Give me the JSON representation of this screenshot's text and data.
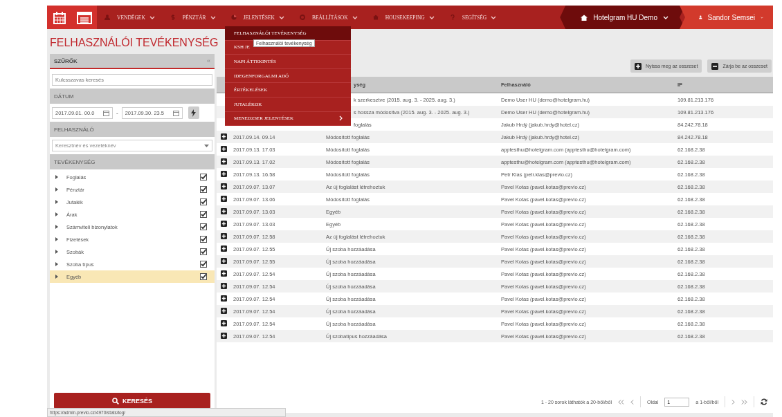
{
  "page_title": "FELHASZNÁLÓI TEVÉKENYSÉG",
  "nav": {
    "items": [
      {
        "label": "VENDÉGEK",
        "kind": "guests"
      },
      {
        "label": "PÉNZTÁR",
        "kind": "cash"
      },
      {
        "label": "JELENTÉSEK",
        "kind": "reports"
      },
      {
        "label": "BEÁLLÍTÁSOK",
        "kind": "settings"
      },
      {
        "label": "HOUSEKEEPING",
        "kind": "housekeeping"
      },
      {
        "label": "SEGÍTSÉG",
        "kind": "help"
      }
    ],
    "hotel": "Hotelgram HU Demo",
    "user": "Sandor Semsei"
  },
  "reports_menu": {
    "items": [
      {
        "label": "FELHASZNÁLÓI TEVÉKENYSÉG",
        "selected": true,
        "submenu": false
      },
      {
        "label": "KSH JE",
        "selected": false,
        "submenu": false
      },
      {
        "label": "NAPI ÁTTEKINTÉS",
        "selected": false,
        "submenu": false
      },
      {
        "label": "IDEGENFORGALMI ADÓ",
        "selected": false,
        "submenu": false
      },
      {
        "label": "ÉRTÉKELÉSEK",
        "selected": false,
        "submenu": false
      },
      {
        "label": "JUTALÉKOK",
        "selected": false,
        "submenu": false
      },
      {
        "label": "MENEDZSER JELENTÉSEK",
        "selected": false,
        "submenu": true
      }
    ],
    "tooltip": "Felhasználói tevékenység"
  },
  "filters": {
    "title": "SZŰRŐK",
    "collapse_symbol": "«",
    "date_separator": "-",
    "keyword": {
      "placeholder": "Kulcsszavas keresés"
    },
    "date_label": "DÁTUM",
    "date_from": "2017.09.01. 00.0",
    "date_to": "2017.09.30. 23.5",
    "user_label": "FELHASZNÁLÓ",
    "user_select": {
      "placeholder": "Keresztnév és vezetéknév"
    },
    "activity_label": "TEVÉKENYSÉG",
    "activities": [
      {
        "label": "Foglalás",
        "checked": true,
        "selected": false
      },
      {
        "label": "Pénztár",
        "checked": true,
        "selected": false
      },
      {
        "label": "Jutalék",
        "checked": true,
        "selected": false
      },
      {
        "label": "Árak",
        "checked": true,
        "selected": false
      },
      {
        "label": "Számviteli bizonylatok",
        "checked": true,
        "selected": false
      },
      {
        "label": "Fizetések",
        "checked": true,
        "selected": false
      },
      {
        "label": "Szobák",
        "checked": true,
        "selected": false
      },
      {
        "label": "Szoba típus",
        "checked": true,
        "selected": false
      },
      {
        "label": "Egyéb",
        "checked": true,
        "selected": true
      }
    ],
    "search_button": "KERESÉS"
  },
  "toolbar": {
    "expand_all": "Nyissa meg az osszeset",
    "collapse_all": "Zárja be az osszeset"
  },
  "table": {
    "columns": [
      "ység",
      "Felhasználó",
      "IP"
    ],
    "rows": [
      {
        "activity": "k szerkesztve (2015. aug. 3. - 2025. aug. 3.)",
        "user": "Demo User HU (demo@hotelgram.hu)",
        "ip": "109.81.213.176"
      },
      {
        "activity": "s hossza módosítva (2015. aug. 3. - 2025. aug. 3.)",
        "user": "Demo User HU (demo@hotelgram.hu)",
        "ip": "109.81.213.176"
      },
      {
        "activity": "foglalás",
        "user": "Jakub Hrdý (jakub.hrdy@hotel.cz)",
        "ip": "84.242.78.18"
      },
      {
        "date": "2017.09.14. 09.14",
        "activity": "Módosított foglalás",
        "user": "Jakub Hrdý (jakub.hrdy@hotel.cz)",
        "ip": "84.242.78.18"
      },
      {
        "date": "2017.09.13. 17.03",
        "activity": "Módosított foglalás",
        "user": "apptesthu@hotelgram.com (apptesthu@hotelgram.com)",
        "ip": "62.168.2.38"
      },
      {
        "date": "2017.09.13. 17.02",
        "activity": "Módosított foglalás",
        "user": "apptesthu@hotelgram.com (apptesthu@hotelgram.com)",
        "ip": "62.168.2.38"
      },
      {
        "date": "2017.09.13. 16.58",
        "activity": "Módosított foglalás",
        "user": "Petr Klas (petr.klas@previo.cz)",
        "ip": "62.168.2.38"
      },
      {
        "date": "2017.09.07. 13.07",
        "activity": "Az új foglalást létrehoztuk",
        "user": "Pavel Kotas (pavel.kotas@previo.cz)",
        "ip": "62.168.2.38"
      },
      {
        "date": "2017.09.07. 13.06",
        "activity": "Módosított foglalás",
        "user": "Pavel Kotas (pavel.kotas@previo.cz)",
        "ip": "62.168.2.38"
      },
      {
        "date": "2017.09.07. 13.03",
        "activity": "Egyéb",
        "user": "Pavel Kotas (pavel.kotas@previo.cz)",
        "ip": "62.168.2.38"
      },
      {
        "date": "2017.09.07. 13.03",
        "activity": "Egyéb",
        "user": "Pavel Kotas (pavel.kotas@previo.cz)",
        "ip": "62.168.2.38"
      },
      {
        "date": "2017.09.07. 12.58",
        "activity": "Az új foglalást létrehoztuk",
        "user": "Pavel Kotas (pavel.kotas@previo.cz)",
        "ip": "62.168.2.38"
      },
      {
        "date": "2017.09.07. 12.55",
        "activity": "Új szoba hozzáadása",
        "user": "Pavel Kotas (pavel.kotas@previo.cz)",
        "ip": "62.168.2.38"
      },
      {
        "date": "2017.09.07. 12.55",
        "activity": "Új szoba hozzáadása",
        "user": "Pavel Kotas (pavel.kotas@previo.cz)",
        "ip": "62.168.2.38"
      },
      {
        "date": "2017.09.07. 12.54",
        "activity": "Új szoba hozzáadása",
        "user": "Pavel Kotas (pavel.kotas@previo.cz)",
        "ip": "62.168.2.38"
      },
      {
        "date": "2017.09.07. 12.54",
        "activity": "Új szoba hozzáadása",
        "user": "Pavel Kotas (pavel.kotas@previo.cz)",
        "ip": "62.168.2.38"
      },
      {
        "date": "2017.09.07. 12.54",
        "activity": "Új szoba hozzáadása",
        "user": "Pavel Kotas (pavel.kotas@previo.cz)",
        "ip": "62.168.2.38"
      },
      {
        "date": "2017.09.07. 12.54",
        "activity": "Új szoba hozzáadása",
        "user": "Pavel Kotas (pavel.kotas@previo.cz)",
        "ip": "62.168.2.38"
      },
      {
        "date": "2017.09.07. 12.54",
        "activity": "Új szoba hozzáadása",
        "user": "Pavel Kotas (pavel.kotas@previo.cz)",
        "ip": "62.168.2.38"
      },
      {
        "date": "2017.09.07. 12.54",
        "activity": "Új szobatípus hozzáadása",
        "user": "Pavel Kotas (pavel.kotas@previo.cz)",
        "ip": "62.168.2.38"
      }
    ]
  },
  "pagination": {
    "summary": "1 - 20 sorok láthatók a 20-ből/ből",
    "page_label": "Oldal",
    "page": "1",
    "page_count": "a 1-ből/ből"
  },
  "status_url": "https://admin.previo.cz/4970/stats/log/"
}
